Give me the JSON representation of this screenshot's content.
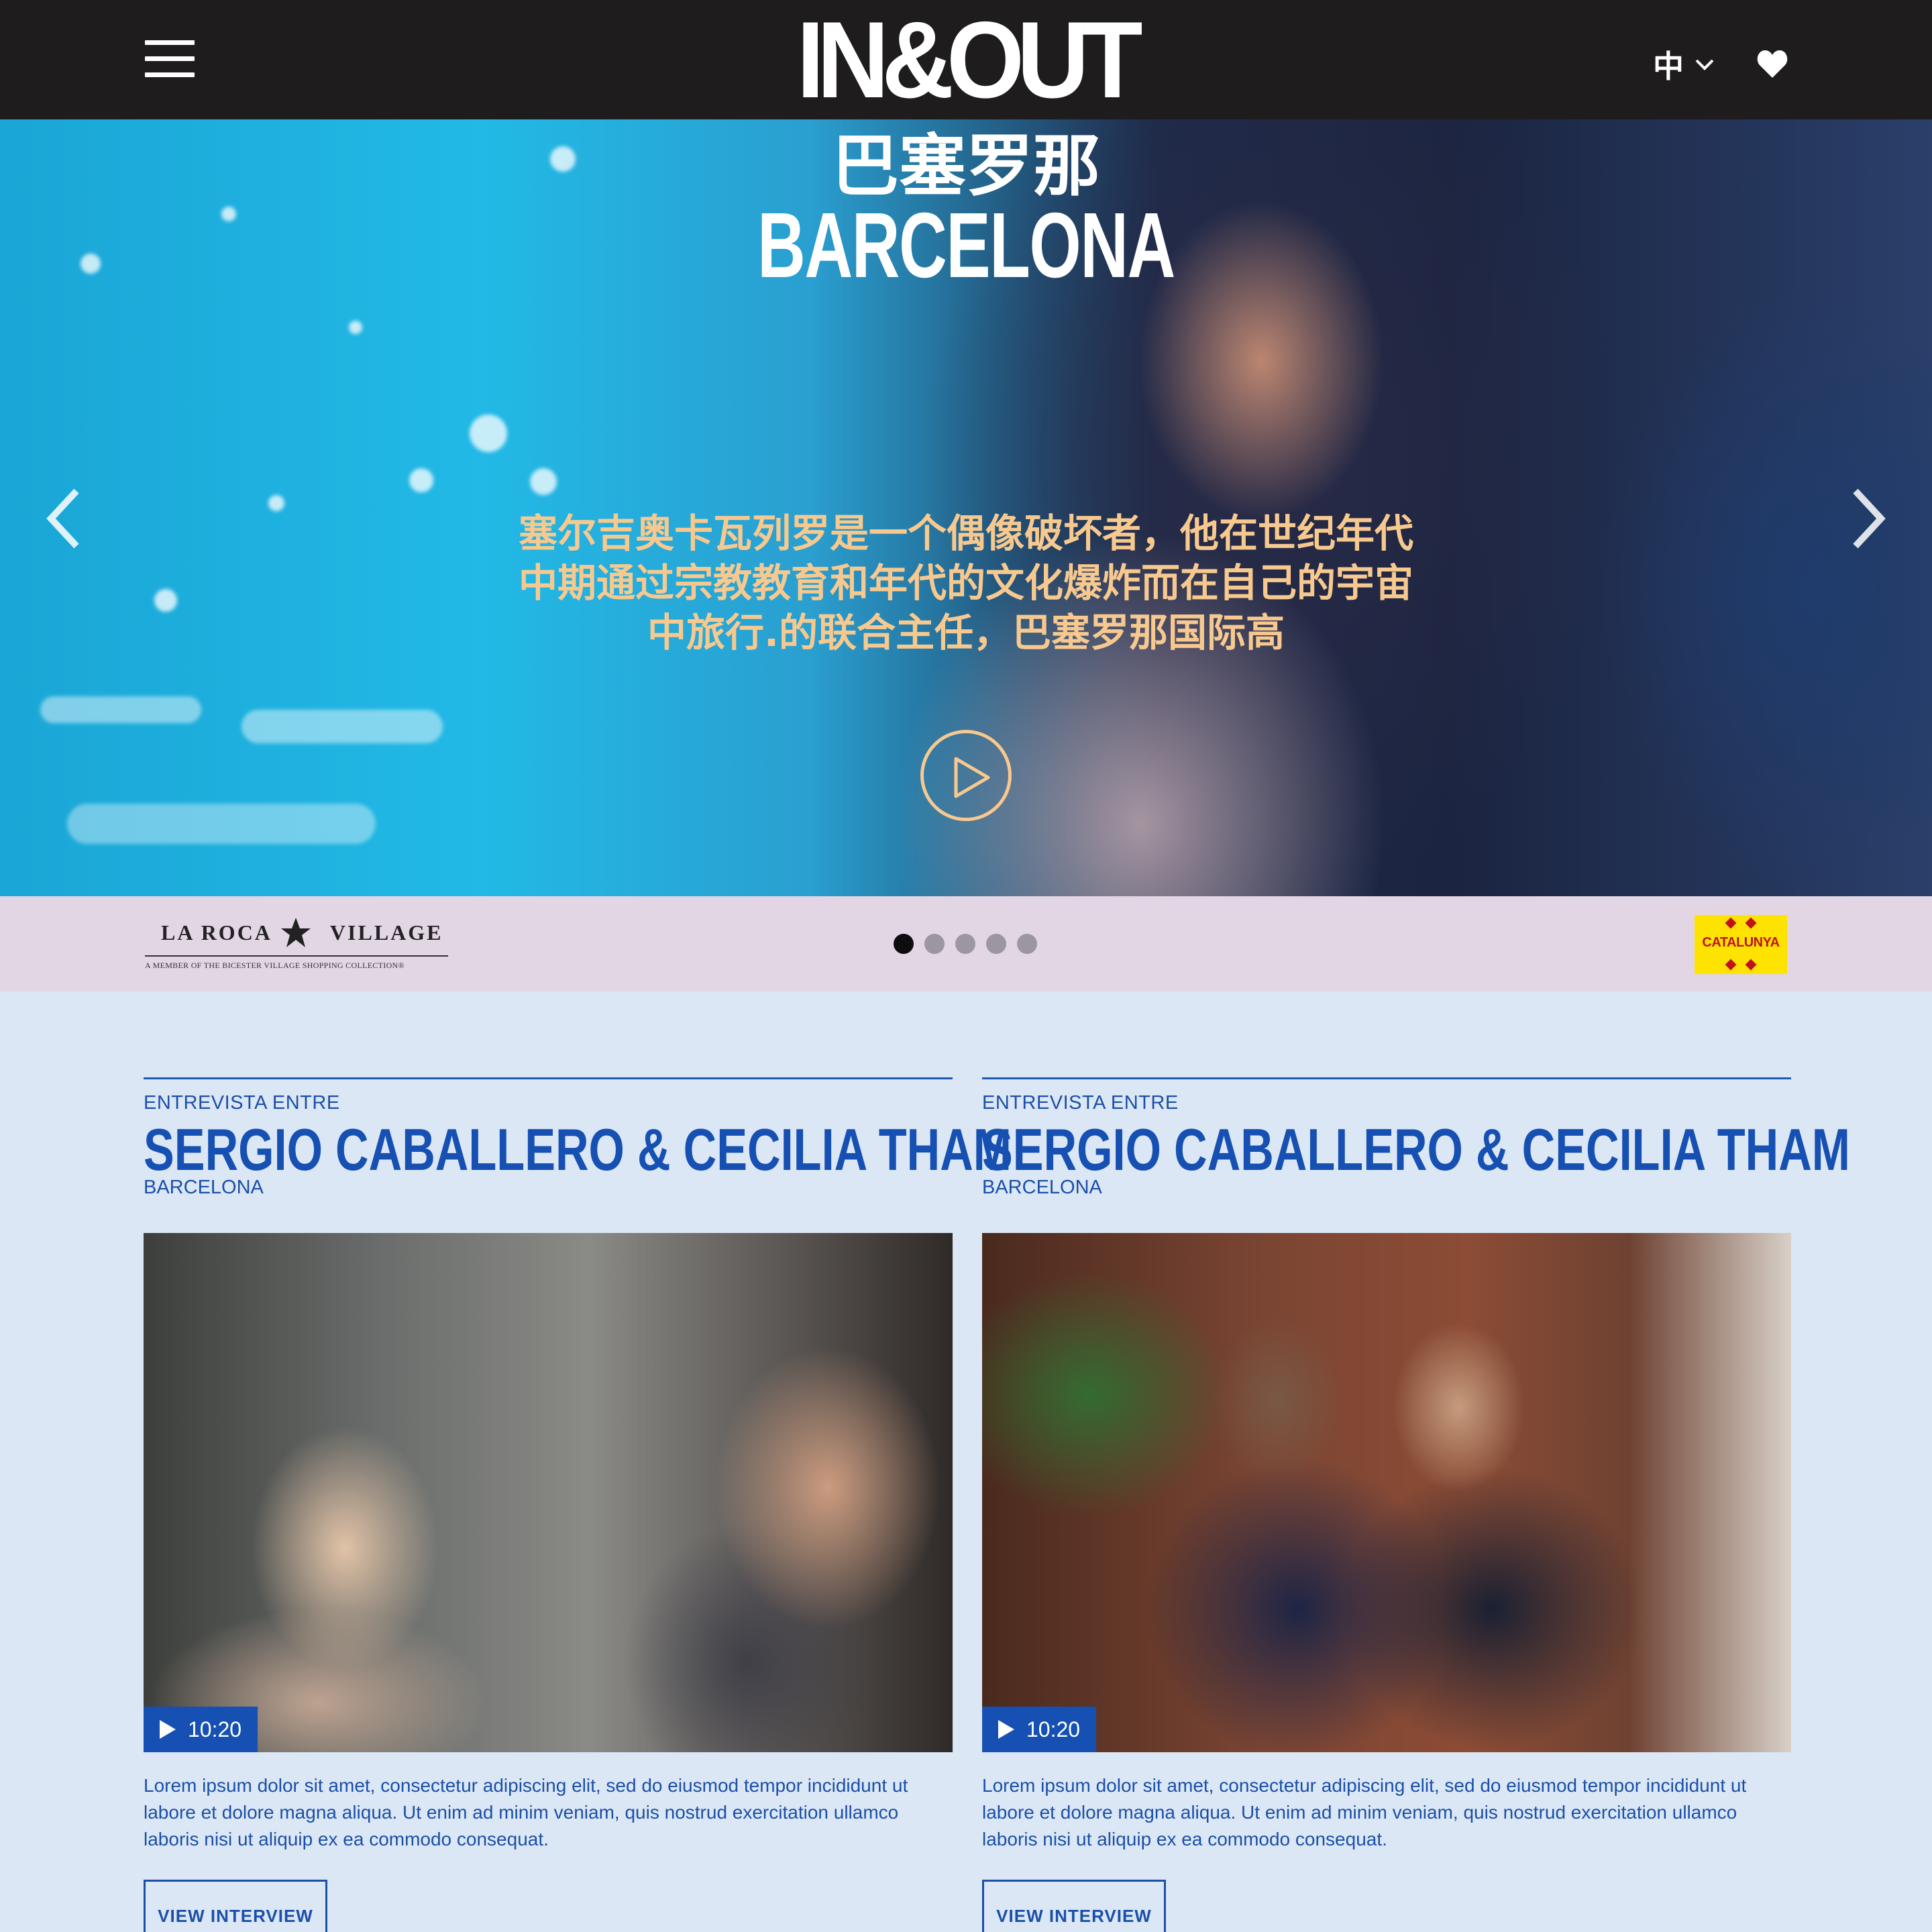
{
  "header": {
    "brand": "IN&OUT",
    "language": "中",
    "menu_icon": "hamburger-menu-icon",
    "lang_icon": "chevron-down-icon",
    "favorite_icon": "heart-icon"
  },
  "hero": {
    "title_cn": "巴塞罗那",
    "title_en": "BARCELONA",
    "text_lines": [
      "塞尔吉奥卡瓦列罗是一个偶像破坏者，他在世纪年代",
      "中期通过宗教教育和年代的文化爆炸而在自己的宇宙",
      "中旅行.的联合主任，巴塞罗那国际高"
    ],
    "accent_color": "#f7c98f",
    "prev_icon": "chevron-left-icon",
    "next_icon": "chevron-right-icon",
    "play_icon": "play-circle-icon"
  },
  "partners": {
    "left_logo_part1": "LA ROCA",
    "left_logo_part2": "VILLAGE",
    "left_logo_tagline": "A MEMBER OF THE BICESTER VILLAGE SHOPPING COLLECTION®",
    "right_logo": "CATALUNYA",
    "carousel_total": 5,
    "carousel_active": 1
  },
  "cards": [
    {
      "eyebrow": "ENTREVISTA ENTRE",
      "name": "SERGIO CABALLERO & CECILIA THAM",
      "city": "BARCELONA",
      "duration": "10:20",
      "description": "Lorem ipsum dolor sit amet, consectetur adipiscing elit, sed do eiusmod tempor incididunt ut labore et dolore magna aliqua. Ut enim ad minim veniam, quis nostrud exercitation ullamco laboris nisi ut aliquip ex ea commodo consequat.",
      "button": "VIEW INTERVIEW"
    },
    {
      "eyebrow": "ENTREVISTA ENTRE",
      "name": "SERGIO CABALLERO & CECILIA THAM",
      "city": "BARCELONA",
      "duration": "10:20",
      "description": "Lorem ipsum dolor sit amet, consectetur adipiscing elit, sed do eiusmod tempor incididunt ut labore et dolore magna aliqua. Ut enim ad minim veniam, quis nostrud exercitation ullamco laboris nisi ut aliquip ex ea commodo consequat.",
      "button": "VIEW INTERVIEW"
    }
  ],
  "colors": {
    "header_bg": "#1e1c1d",
    "strip_bg": "#e2d6e4",
    "page_bg": "#dbe7f5",
    "link_blue": "#1650b2"
  }
}
